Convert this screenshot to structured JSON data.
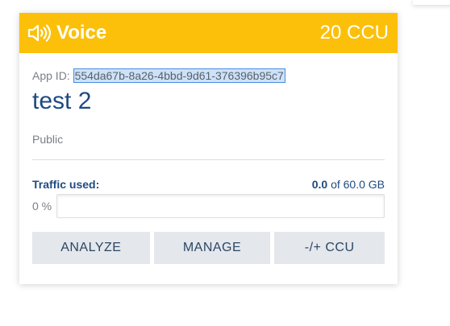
{
  "card": {
    "product_icon": "speaker-volume-icon",
    "product_name": "Voice",
    "ccu": "20 CCU",
    "app_id_label": "App ID:",
    "app_id": "554da67b-8a26-4bbd-9d61-376396b95c7",
    "app_name": "test 2",
    "visibility": "Public",
    "traffic": {
      "label": "Traffic used:",
      "used": "0.0",
      "total": "of 60.0 GB",
      "percent_label": "0 %",
      "percent_value": 0
    },
    "buttons": {
      "analyze": "ANALYZE",
      "manage": "MANAGE",
      "ccu": "-/+ CCU"
    }
  },
  "colors": {
    "header": "#fcc00a",
    "title": "#1f4a80",
    "button_bg": "#e4e7eb"
  }
}
